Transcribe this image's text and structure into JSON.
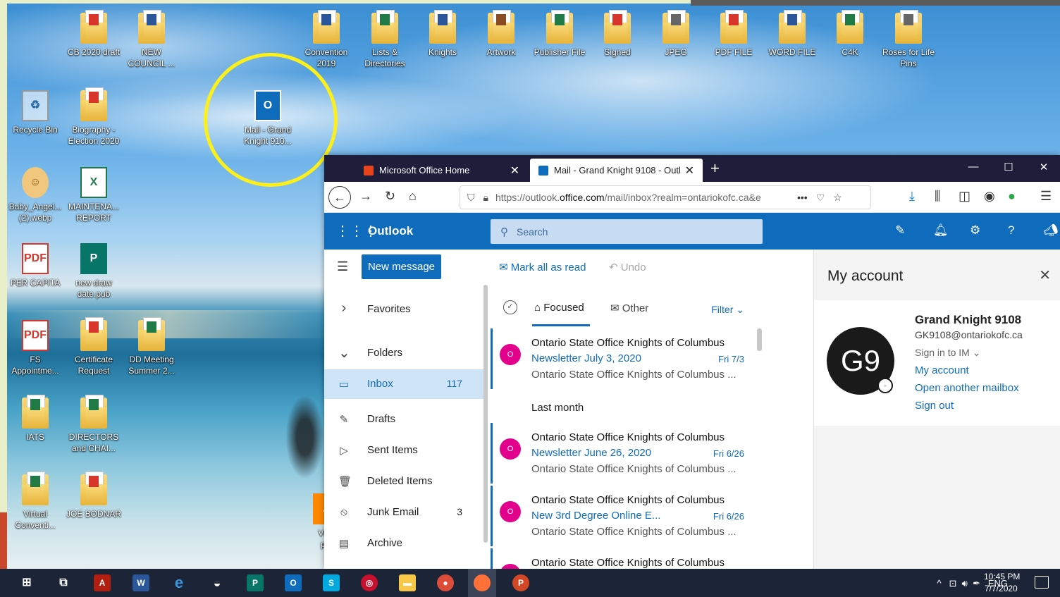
{
  "desktop": {
    "icons": [
      {
        "label": "CB 2020 draft",
        "kind": "pdf-folder"
      },
      {
        "label": "NEW\nCOUNCIL ...",
        "kind": "doc-folder"
      },
      {
        "label": "Convention\n2019",
        "kind": "doc-folder"
      },
      {
        "label": "Lists &\nDirectories",
        "kind": "xls-folder"
      },
      {
        "label": "Knights",
        "kind": "doc-folder"
      },
      {
        "label": "Artwork",
        "kind": "art-folder"
      },
      {
        "label": "Publisher File",
        "kind": "xls-folder"
      },
      {
        "label": "Signed",
        "kind": "pdf-folder"
      },
      {
        "label": "JPEG",
        "kind": "img-folder"
      },
      {
        "label": "PDF FILE",
        "kind": "pdf-folder"
      },
      {
        "label": "WORD FILE",
        "kind": "doc-folder"
      },
      {
        "label": "C4K",
        "kind": "xls-folder"
      },
      {
        "label": "Roses for Life\nPins",
        "kind": "img-folder"
      },
      {
        "label": "Recycle Bin",
        "kind": "recycle-bin"
      },
      {
        "label": "Biography -\nElection 2020",
        "kind": "pdf-folder"
      },
      {
        "label": "Mail - Grand\nKnight 910...",
        "kind": "outlook-shortcut"
      },
      {
        "label": "Baby_Angel...\n(2).webp",
        "kind": "image-file"
      },
      {
        "label": "MAINTENA...\nREPORT",
        "kind": "excel-file"
      },
      {
        "label": "PER CAPITA",
        "kind": "pdf-file"
      },
      {
        "label": "new draw\ndate.pub",
        "kind": "publisher-file"
      },
      {
        "label": "FS\nAppointme...",
        "kind": "pdf-file"
      },
      {
        "label": "Certificate\nRequest",
        "kind": "pdf-folder"
      },
      {
        "label": "DD Meeting\nSummer 2...",
        "kind": "xls-folder"
      },
      {
        "label": "IATS",
        "kind": "xls-folder"
      },
      {
        "label": "DIRECTORS\nand CHAI...",
        "kind": "xls-folder"
      },
      {
        "label": "Virtual\nConventi...",
        "kind": "xls-folder"
      },
      {
        "label": "JOE BODNAR",
        "kind": "pdf-folder"
      },
      {
        "label": "VLC\npla",
        "kind": "vlc-shortcut"
      }
    ]
  },
  "browser": {
    "tabs": [
      {
        "title": "Microsoft Office Home",
        "icon": "office-icon"
      },
      {
        "title": "Mail - Grand Knight 9108 - Outl",
        "icon": "outlook-icon"
      }
    ],
    "url_prefix": "https://outlook.",
    "url_domain": "office.com",
    "url_suffix": "/mail/inbox?realm=ontariokofc.ca&e",
    "overflow_glyph": "•••"
  },
  "outlook": {
    "app_name": "Outlook",
    "search_placeholder": "Search",
    "new_message": "New message",
    "mark_all_read": "Mark all as read",
    "undo": "Undo",
    "folders": [
      {
        "label": "Favorites",
        "icon": "chevron-right-icon",
        "count": ""
      },
      {
        "label": "Folders",
        "icon": "chevron-down-icon",
        "count": ""
      },
      {
        "label": "Inbox",
        "icon": "inbox-icon",
        "count": "117"
      },
      {
        "label": "Drafts",
        "icon": "pencil-icon",
        "count": ""
      },
      {
        "label": "Sent Items",
        "icon": "send-icon",
        "count": ""
      },
      {
        "label": "Deleted Items",
        "icon": "trash-icon",
        "count": ""
      },
      {
        "label": "Junk Email",
        "icon": "block-icon",
        "count": "3"
      },
      {
        "label": "Archive",
        "icon": "archive-icon",
        "count": ""
      }
    ],
    "pivot": {
      "focused": "Focused",
      "other": "Other",
      "filter": "Filter"
    },
    "group_label": "Last month",
    "messages": [
      {
        "sender": "Ontario State Office Knights of Columbus",
        "subject": "Newsletter July 3, 2020",
        "date": "Fri 7/3",
        "preview": "Ontario State Office Knights of Columbus ...",
        "avatar": "O"
      },
      {
        "sender": "Ontario State Office Knights of Columbus",
        "subject": "Newsletter June 26, 2020",
        "date": "Fri 6/26",
        "preview": "Ontario State Office Knights of Columbus ...",
        "avatar": "O"
      },
      {
        "sender": "Ontario State Office Knights of Columbus",
        "subject": "New 3rd Degree  Online E...",
        "date": "Fri 6/26",
        "preview": "Ontario State Office Knights of Columbus ...",
        "avatar": "O"
      },
      {
        "sender": "Ontario State Office Knights of Columbus",
        "subject": "",
        "date": "",
        "preview": "",
        "avatar": "O"
      }
    ],
    "account": {
      "title": "My account",
      "initials": "G9",
      "name": "Grand Knight 9108",
      "email": "GK9108@ontariokofc.ca",
      "im_status": "Sign in to IM",
      "my_account_link": "My account",
      "open_mailbox_link": "Open another mailbox",
      "sign_out_link": "Sign out"
    }
  },
  "taskbar": {
    "language": "ENG",
    "time": "10:45 PM",
    "date": "7/7/2020"
  },
  "colors": {
    "outlook_blue": "#0f6cbd",
    "highlight_yellow": "#fdf01a",
    "tab_bar": "#1e1e3a",
    "taskbar": "#1c2538"
  }
}
